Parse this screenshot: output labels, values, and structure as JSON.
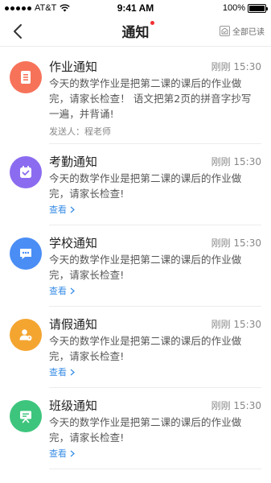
{
  "status_bar": {
    "carrier": "AT&T",
    "time": "9:41 AM",
    "battery_percent": "100%"
  },
  "nav": {
    "title": "通知",
    "read_all_label": "全部已读"
  },
  "colors": {
    "homework": "#f6735a",
    "attendance": "#8b6cf0",
    "school": "#4a8df5",
    "leave": "#f4a530",
    "class": "#3ec57d",
    "link": "#3a8ee6",
    "badge": "#f23030"
  },
  "notifications": [
    {
      "title": "作业通知",
      "time": "刚刚 15:30",
      "body": "今天的数学作业是把第二课的课后的作业做完，请家长检查！ 语文把第2页的拼音字抄写一遍，并背诵!",
      "sender": "发送人：程老师",
      "icon": "document-icon"
    },
    {
      "title": "考勤通知",
      "time": "刚刚 15:30",
      "body": "今天的数学作业是把第二课的课后的作业做完，请家长检查!",
      "link": "查看",
      "icon": "calendar-check-icon"
    },
    {
      "title": "学校通知",
      "time": "刚刚 15:30",
      "body": "今天的数学作业是把第二课的课后的作业做完，请家长检查!",
      "link": "查看",
      "icon": "chat-bubble-icon"
    },
    {
      "title": "请假通知",
      "time": "刚刚 15:30",
      "body": "今天的数学作业是把第二课的课后的作业做完，请家长检查!",
      "link": "查看",
      "icon": "person-clock-icon"
    },
    {
      "title": "班级通知",
      "time": "刚刚 15:30",
      "body": "今天的数学作业是把第二课的课后的作业做完，请家长检查!",
      "link": "查看",
      "icon": "board-icon"
    }
  ]
}
